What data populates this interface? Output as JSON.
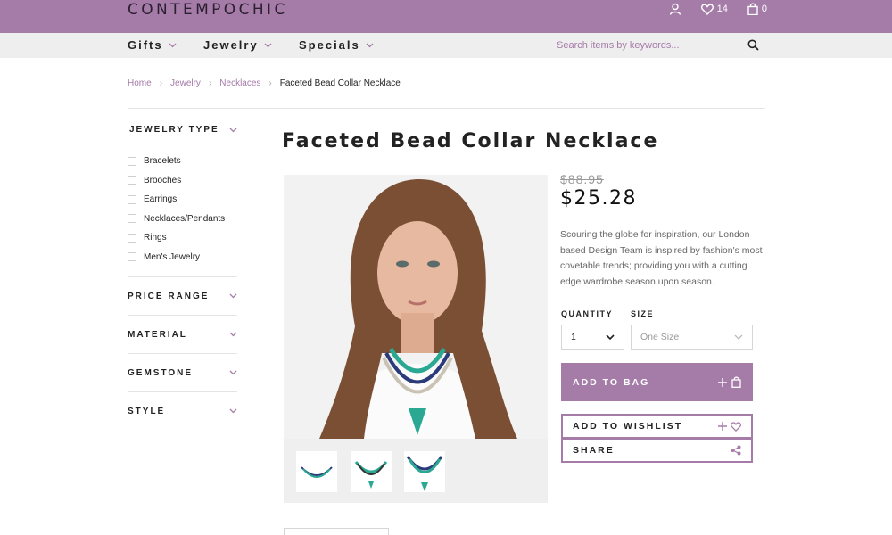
{
  "header": {
    "logo": "CONTEMPOCHIC",
    "wishlist_count": "14",
    "bag_count": "0",
    "colors": {
      "accent": "#a57ba8",
      "nav_bg": "#eeeeee"
    }
  },
  "nav": {
    "items": [
      {
        "label": "Gifts"
      },
      {
        "label": "Jewelry"
      },
      {
        "label": "Specials"
      }
    ],
    "search_placeholder": "Search items by keywords..."
  },
  "breadcrumb": {
    "items": [
      "Home",
      "Jewelry",
      "Necklaces"
    ],
    "current": "Faceted Bead Collar Necklace"
  },
  "filters": {
    "jewelry_type": {
      "label": "JEWELRY TYPE",
      "options": [
        "Bracelets",
        "Brooches",
        "Earrings",
        "Necklaces/Pendants",
        "Rings",
        "Men's Jewelry"
      ]
    },
    "sections": [
      "PRICE RANGE",
      "MATERIAL",
      "GEMSTONE",
      "STYLE"
    ]
  },
  "product": {
    "title": "Faceted Bead Collar Necklace",
    "old_price": "$88.95",
    "price": "$25.28",
    "description": "Scouring the globe for inspiration, our London based Design Team is inspired by fashion's most covetable trends; providing you with a cutting edge wardrobe season upon season.",
    "quantity_label": "QUANTITY",
    "quantity_value": "1",
    "size_label": "SIZE",
    "size_value": "One Size",
    "add_to_bag": "ADD TO BAG",
    "add_to_wishlist": "ADD TO WISHLIST",
    "share": "SHARE"
  }
}
